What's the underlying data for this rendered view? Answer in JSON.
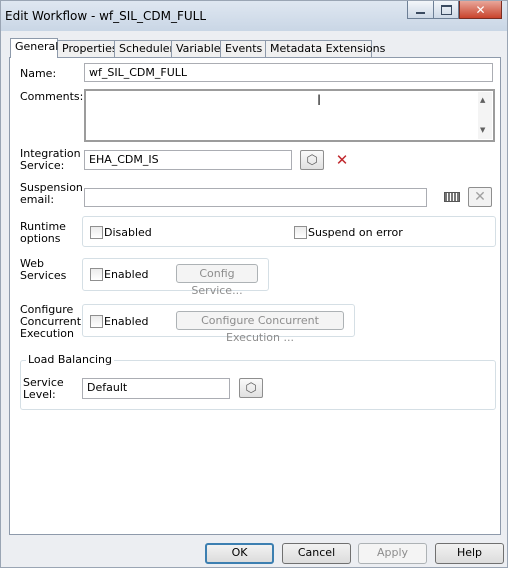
{
  "window": {
    "title": "Edit Workflow - wf_SIL_CDM_FULL"
  },
  "tabs": [
    {
      "label": "General"
    },
    {
      "label": "Properties"
    },
    {
      "label": "Scheduler"
    },
    {
      "label": "Variables"
    },
    {
      "label": "Events"
    },
    {
      "label": "Metadata Extensions"
    }
  ],
  "general": {
    "name_label": "Name:",
    "name_value": "wf_SIL_CDM_FULL",
    "comments_label": "Comments:",
    "comments_value": "",
    "integration_label": "Integration\nService:",
    "integration_value": "EHA_CDM_IS",
    "suspension_label": "Suspension\nemail:",
    "suspension_value": "",
    "runtime_label": "Runtime\noptions",
    "disabled_label": "Disabled",
    "suspend_label": "Suspend on error",
    "webservices_label": "Web\nServices",
    "ws_enabled_label": "Enabled",
    "config_service_label": "Config Service...",
    "concurrent_label": "Configure\nConcurrent\nExecution",
    "ce_enabled_label": "Enabled",
    "configure_ce_label": "Configure Concurrent Execution ...",
    "load_balancing_label": "Load Balancing",
    "service_level_label": "Service\nLevel:",
    "service_level_value": "Default"
  },
  "buttons": {
    "ok": "OK",
    "cancel": "Cancel",
    "apply": "Apply",
    "help": "Help"
  },
  "colors": {
    "close_red": "#c9432c",
    "remove_x_red": "#c0282d",
    "tab_border": "#8e9aab"
  }
}
